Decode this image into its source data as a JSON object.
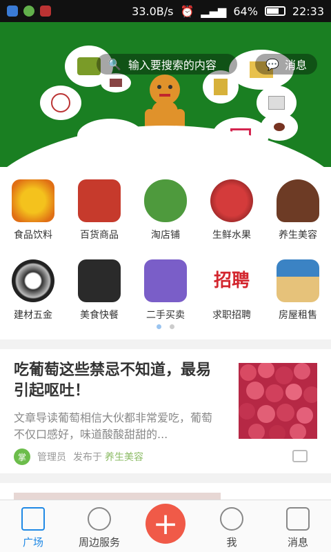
{
  "status": {
    "speed": "33.0B/s",
    "battery": "64%",
    "time": "22:33"
  },
  "hero": {
    "search_placeholder": "输入要搜索的内容",
    "message_label": "消息"
  },
  "categories": [
    {
      "label": "食品饮料",
      "icon": "food-icon"
    },
    {
      "label": "百货商品",
      "icon": "store-icon"
    },
    {
      "label": "淘店铺",
      "icon": "shop-icon"
    },
    {
      "label": "生鲜水果",
      "icon": "fruit-icon"
    },
    {
      "label": "养生美容",
      "icon": "beauty-icon"
    },
    {
      "label": "建材五金",
      "icon": "hardware-icon"
    },
    {
      "label": "美食快餐",
      "icon": "fastfood-icon"
    },
    {
      "label": "二手买卖",
      "icon": "secondhand-icon"
    },
    {
      "label": "求职招聘",
      "icon": "jobs-icon"
    },
    {
      "label": "房屋租售",
      "icon": "house-icon"
    }
  ],
  "article": {
    "title": "吃葡萄这些禁忌不知道，最易引起呕吐！",
    "desc": "文章导读葡萄相信大伙都非常爱吃，葡萄不仅口感好，味道酸酸甜甜的...",
    "author": "管理员",
    "posted_in": "发布于",
    "category": "养生美容",
    "avatar_text": "掌"
  },
  "tabs": [
    {
      "label": "广场",
      "icon": "plaza-icon"
    },
    {
      "label": "周边服务",
      "icon": "location-icon"
    },
    {
      "label": "我",
      "icon": "user-icon"
    },
    {
      "label": "消息",
      "icon": "house-msg-icon"
    }
  ],
  "fab_label": "+"
}
